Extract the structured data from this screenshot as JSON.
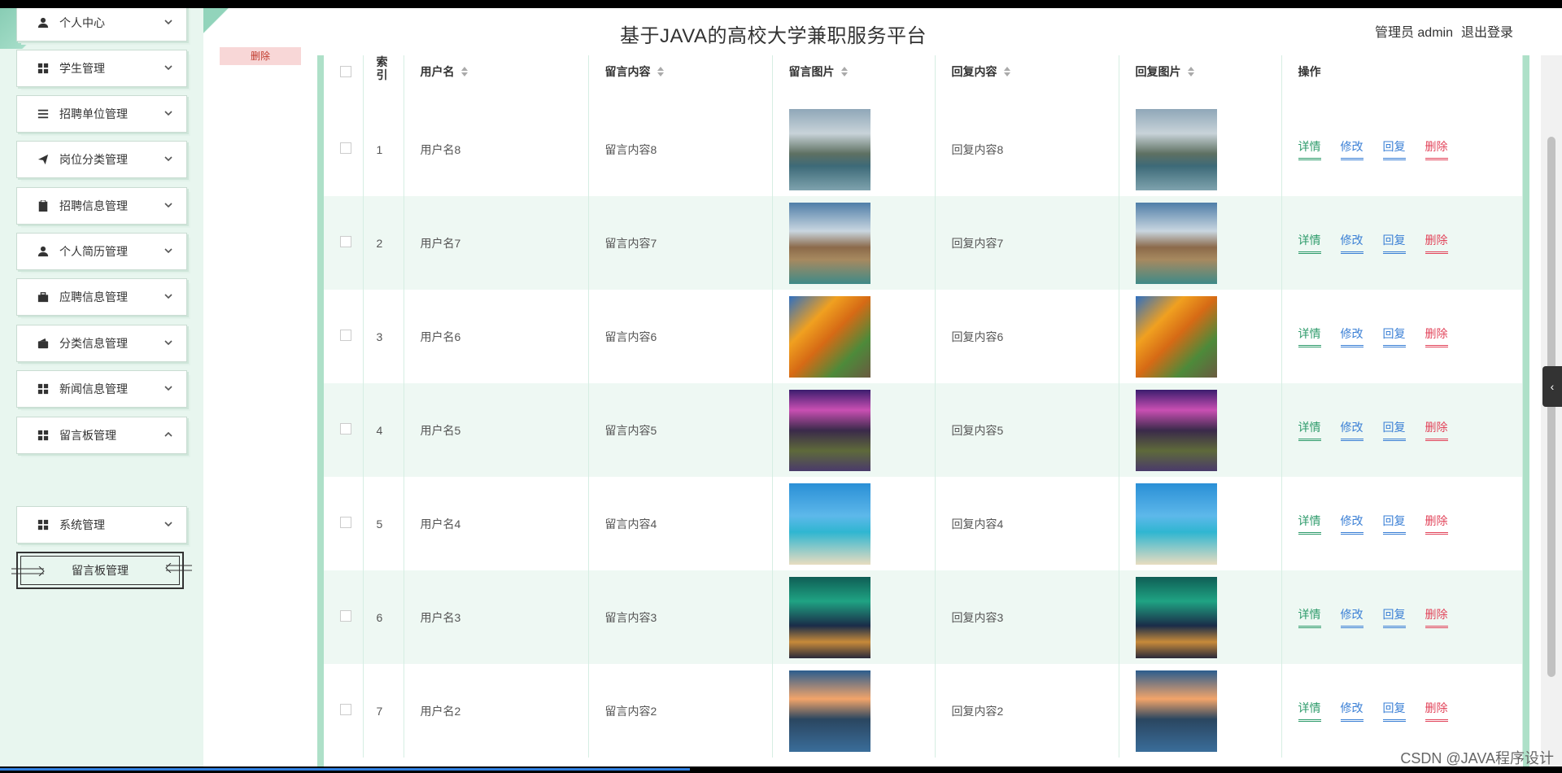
{
  "header": {
    "title": "基于JAVA的高校大学兼职服务平台",
    "user": "管理员 admin",
    "logout": "退出登录"
  },
  "sidebar": {
    "items": [
      {
        "label": "个人中心",
        "icon": "user-icon",
        "expanded": false
      },
      {
        "label": "学生管理",
        "icon": "grid-icon",
        "expanded": false
      },
      {
        "label": "招聘单位管理",
        "icon": "list-icon",
        "expanded": false
      },
      {
        "label": "岗位分类管理",
        "icon": "send-icon",
        "expanded": false
      },
      {
        "label": "招聘信息管理",
        "icon": "clipboard-icon",
        "expanded": false
      },
      {
        "label": "个人简历管理",
        "icon": "user-icon",
        "expanded": false
      },
      {
        "label": "应聘信息管理",
        "icon": "briefcase-icon",
        "expanded": false
      },
      {
        "label": "分类信息管理",
        "icon": "wallet-icon",
        "expanded": false
      },
      {
        "label": "新闻信息管理",
        "icon": "grid-icon",
        "expanded": false
      },
      {
        "label": "留言板管理",
        "icon": "grid-icon",
        "expanded": true
      },
      {
        "label": "系统管理",
        "icon": "grid-icon",
        "expanded": false
      }
    ],
    "sub_item": "留言板管理"
  },
  "toolbar": {
    "delete_label": "删除"
  },
  "table": {
    "columns": [
      "索引",
      "用户名",
      "留言内容",
      "留言图片",
      "回复内容",
      "回复图片",
      "操作"
    ],
    "rows": [
      {
        "index": "1",
        "username": "用户名8",
        "message": "留言内容8",
        "reply": "回复内容8",
        "image": "lake-mountain"
      },
      {
        "index": "2",
        "username": "用户名7",
        "message": "留言内容7",
        "reply": "回复内容7",
        "image": "sea-arch"
      },
      {
        "index": "3",
        "username": "用户名6",
        "message": "留言内容6",
        "reply": "回复内容6",
        "image": "autumn-trees"
      },
      {
        "index": "4",
        "username": "用户名5",
        "message": "留言内容5",
        "reply": "回复内容5",
        "image": "purple-coast"
      },
      {
        "index": "5",
        "username": "用户名4",
        "message": "留言内容4",
        "reply": "回复内容4",
        "image": "tropical-beach"
      },
      {
        "index": "6",
        "username": "用户名3",
        "message": "留言内容3",
        "reply": "回复内容3",
        "image": "aurora-cabin"
      },
      {
        "index": "7",
        "username": "用户名2",
        "message": "留言内容2",
        "reply": "回复内容2",
        "image": "karst-dawn"
      }
    ],
    "actions": {
      "detail": "详情",
      "edit": "修改",
      "reply": "回复",
      "delete": "删除"
    }
  },
  "watermark": "CSDN @JAVA程序设计",
  "colors": {
    "accent": "#2e9b6b",
    "link": "#3a7fd5",
    "danger": "#e2455b",
    "sidebar_bg": "#e8f6ef"
  }
}
